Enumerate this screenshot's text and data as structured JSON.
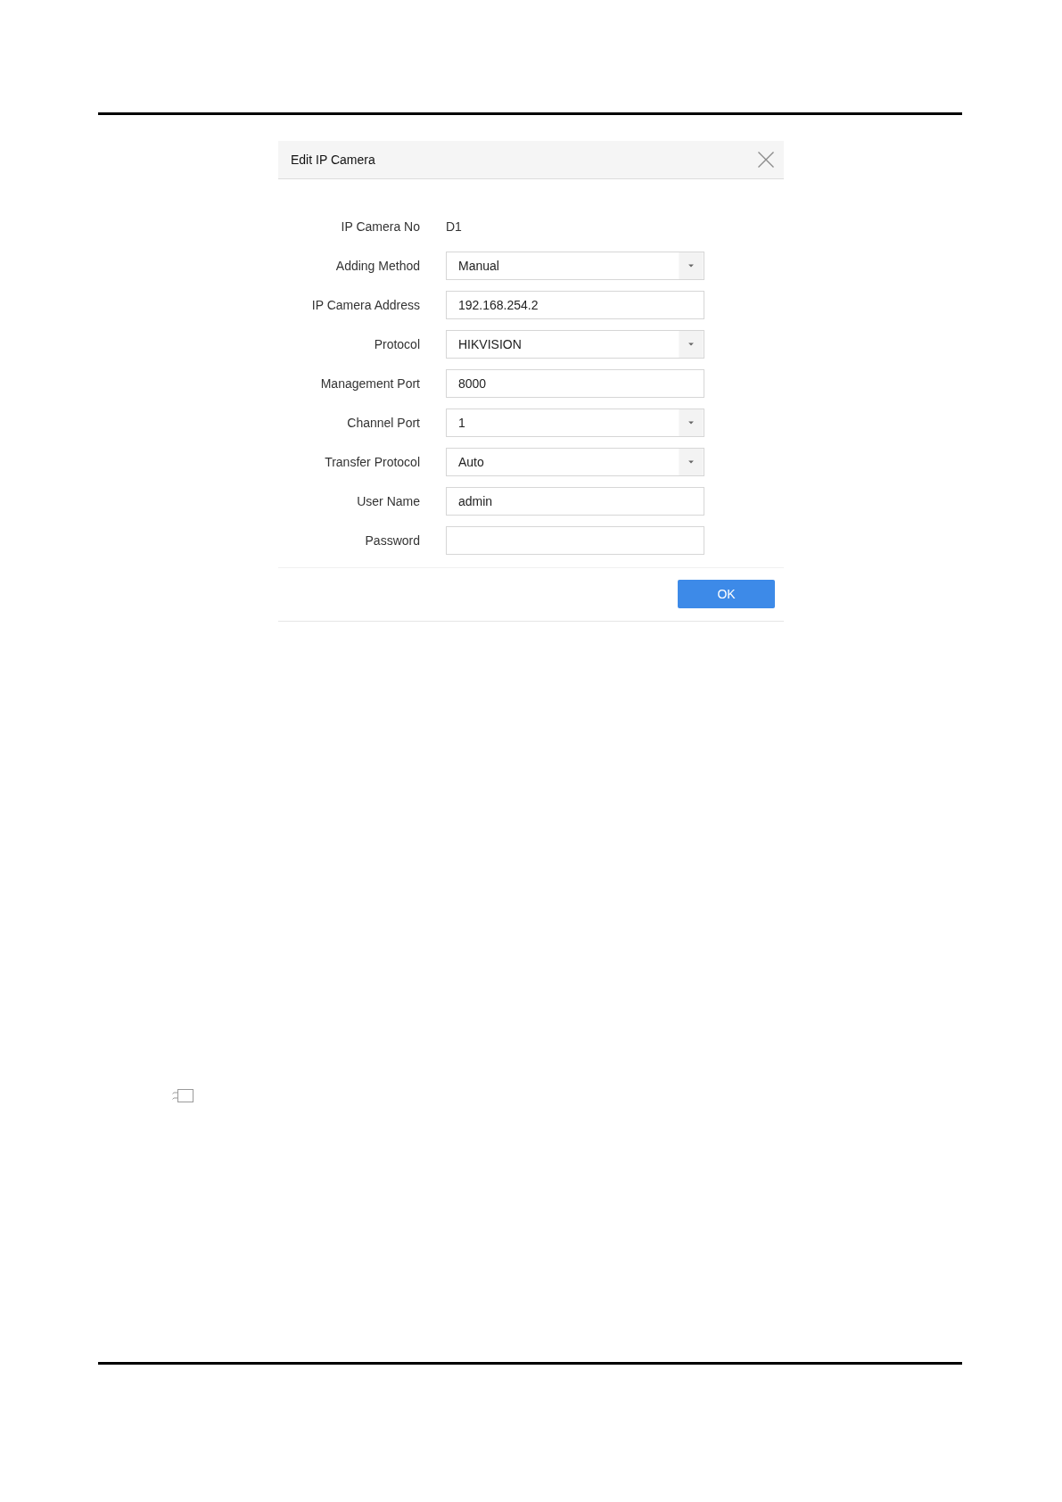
{
  "dialog": {
    "title": "Edit IP Camera",
    "fields": [
      {
        "label": "IP Camera No",
        "kind": "text",
        "value": "D1"
      },
      {
        "label": "Adding Method",
        "kind": "dropdown",
        "value": "Manual"
      },
      {
        "label": "IP Camera Address",
        "kind": "input",
        "value": "192.168.254.2"
      },
      {
        "label": "Protocol",
        "kind": "dropdown",
        "value": "HIKVISION"
      },
      {
        "label": "Management Port",
        "kind": "input",
        "value": "8000"
      },
      {
        "label": "Channel Port",
        "kind": "dropdown",
        "value": "1"
      },
      {
        "label": "Transfer Protocol",
        "kind": "dropdown",
        "value": "Auto"
      },
      {
        "label": "User Name",
        "kind": "input",
        "value": "admin"
      },
      {
        "label": "Password",
        "kind": "input"
      }
    ],
    "buttons": [
      {
        "label": "OK"
      }
    ]
  }
}
